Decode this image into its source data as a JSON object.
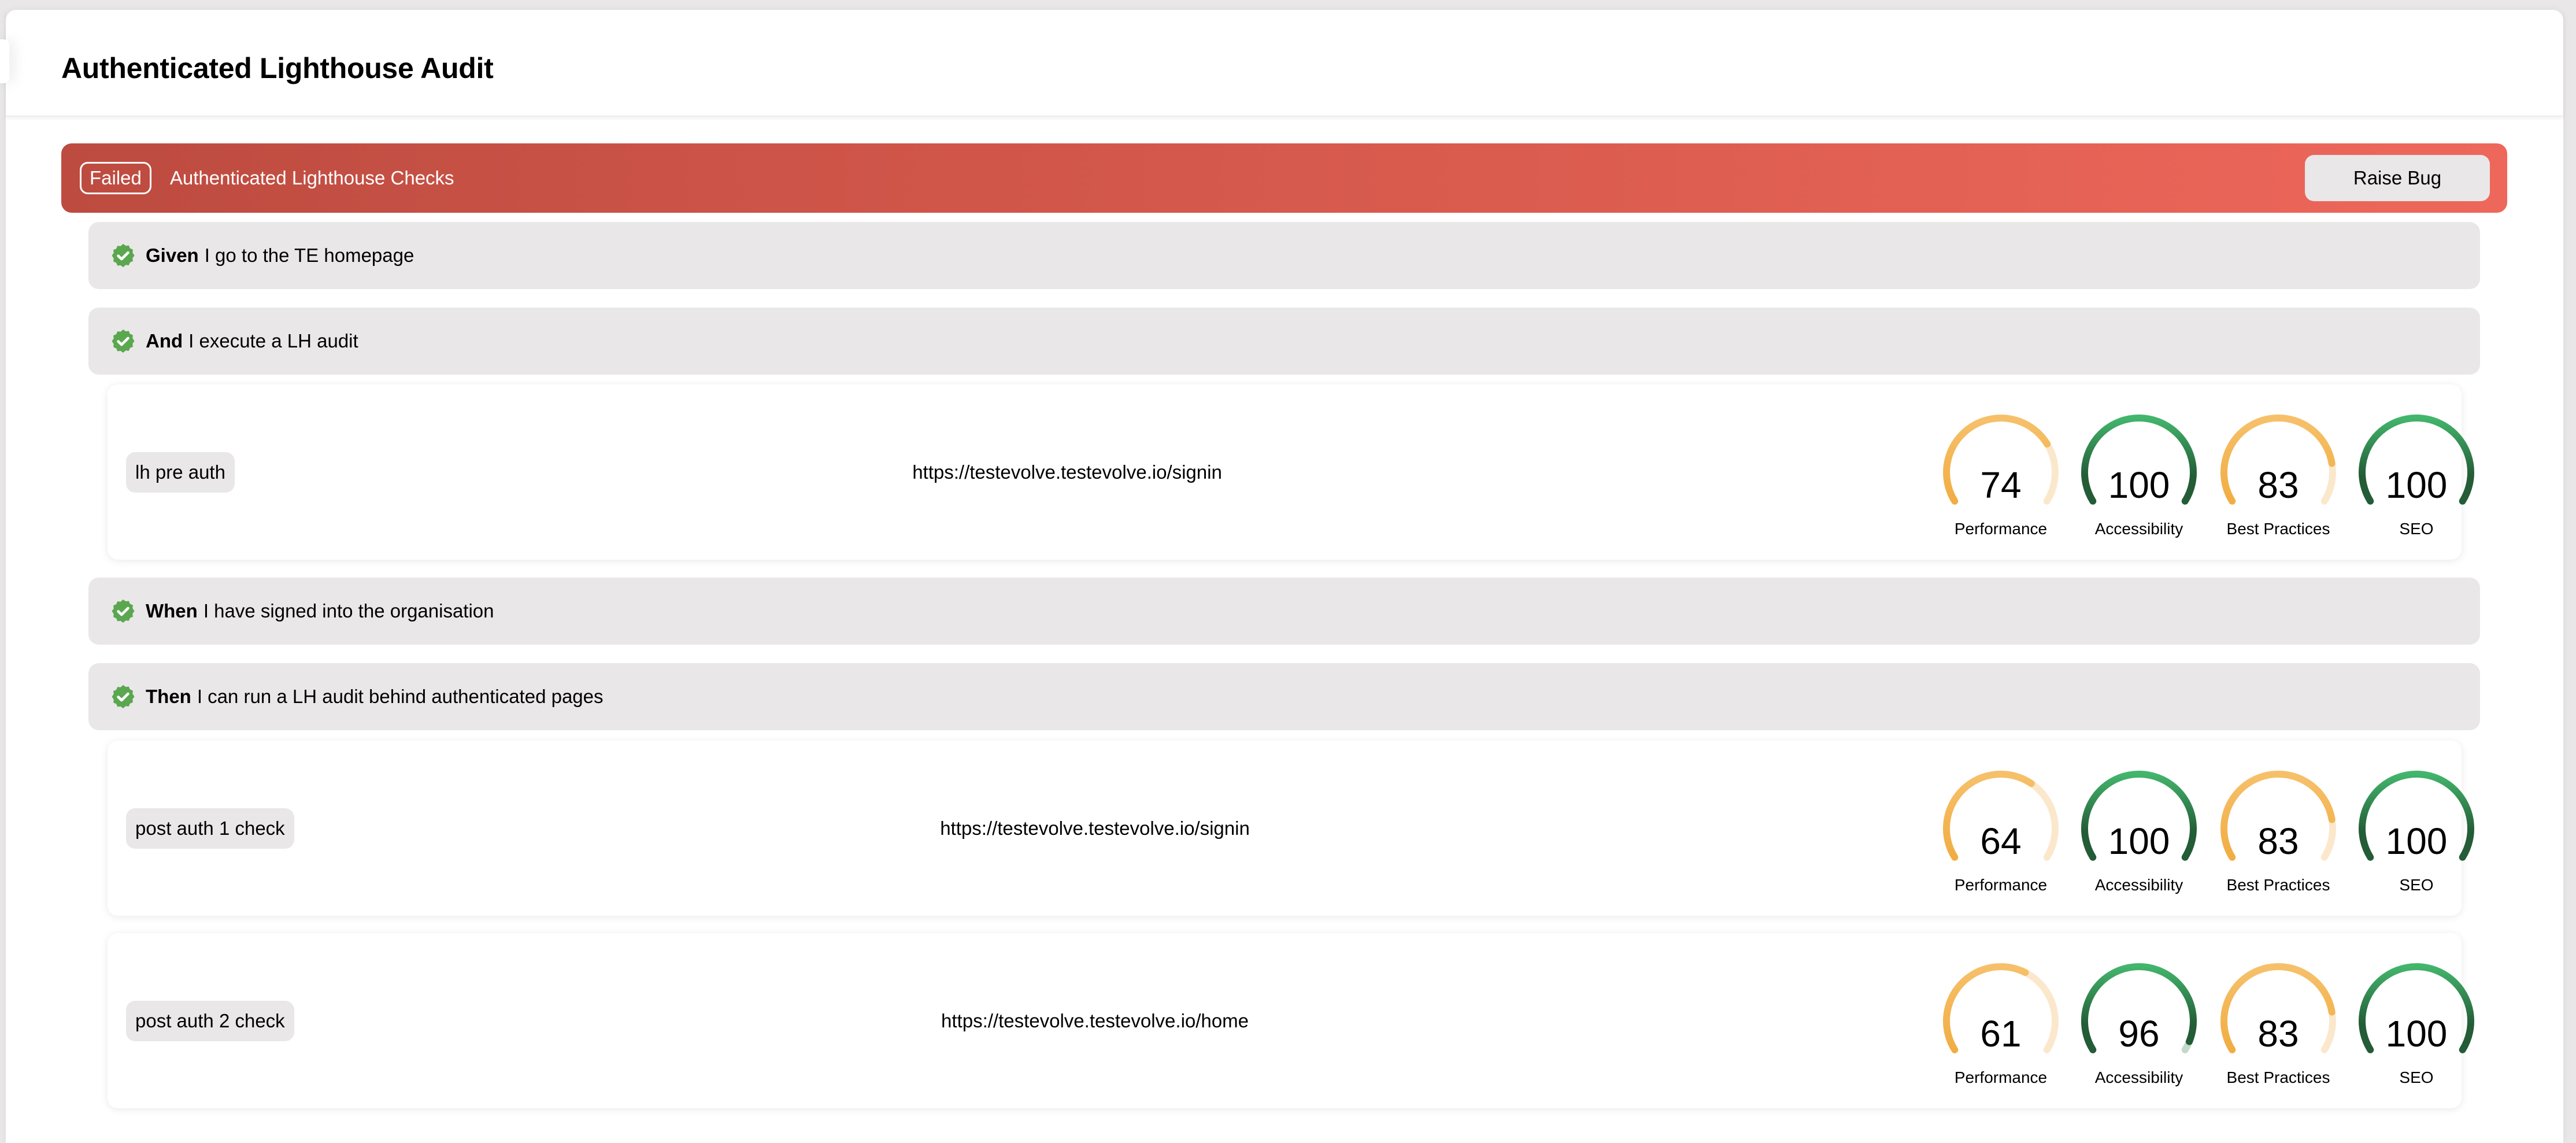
{
  "header": {
    "title": "Authenticated Lighthouse Audit"
  },
  "scenario": {
    "status": "Failed",
    "name": "Authenticated Lighthouse Checks",
    "raise_bug_label": "Raise Bug",
    "status_color": "#d85b4e"
  },
  "steps": [
    {
      "keyword": "Given",
      "text": "I go to the TE homepage",
      "status": "passed",
      "icon": "check-badge-icon"
    },
    {
      "keyword": "And",
      "text": "I execute a LH audit",
      "status": "passed",
      "icon": "check-badge-icon"
    },
    {
      "keyword": "When",
      "text": "I have signed into the organisation",
      "status": "passed",
      "icon": "check-badge-icon"
    },
    {
      "keyword": "Then",
      "text": "I can run a LH audit behind authenticated pages",
      "status": "passed",
      "icon": "check-badge-icon"
    }
  ],
  "results": [
    {
      "tag": "lh pre auth",
      "url": "https://testevolve.testevolve.io/signin",
      "scores": [
        {
          "label": "Performance",
          "value": 74
        },
        {
          "label": "Accessibility",
          "value": 100
        },
        {
          "label": "Best Practices",
          "value": 83
        },
        {
          "label": "SEO",
          "value": 100
        }
      ]
    },
    {
      "tag": "post auth 1 check",
      "url": "https://testevolve.testevolve.io/signin",
      "scores": [
        {
          "label": "Performance",
          "value": 64
        },
        {
          "label": "Accessibility",
          "value": 100
        },
        {
          "label": "Best Practices",
          "value": 83
        },
        {
          "label": "SEO",
          "value": 100
        }
      ]
    },
    {
      "tag": "post auth 2 check",
      "url": "https://testevolve.testevolve.io/home",
      "scores": [
        {
          "label": "Performance",
          "value": 61
        },
        {
          "label": "Accessibility",
          "value": 96
        },
        {
          "label": "Best Practices",
          "value": 83
        },
        {
          "label": "SEO",
          "value": 100
        }
      ]
    }
  ],
  "colors": {
    "pass_icon": "#5aa74f",
    "average_start": "#f1ad43",
    "average_end": "#f6c06a",
    "average_track": "#fbe8cc",
    "good_top": "#43b56c",
    "good_bottom": "#235c36",
    "good_track": "#c4d9ca"
  }
}
